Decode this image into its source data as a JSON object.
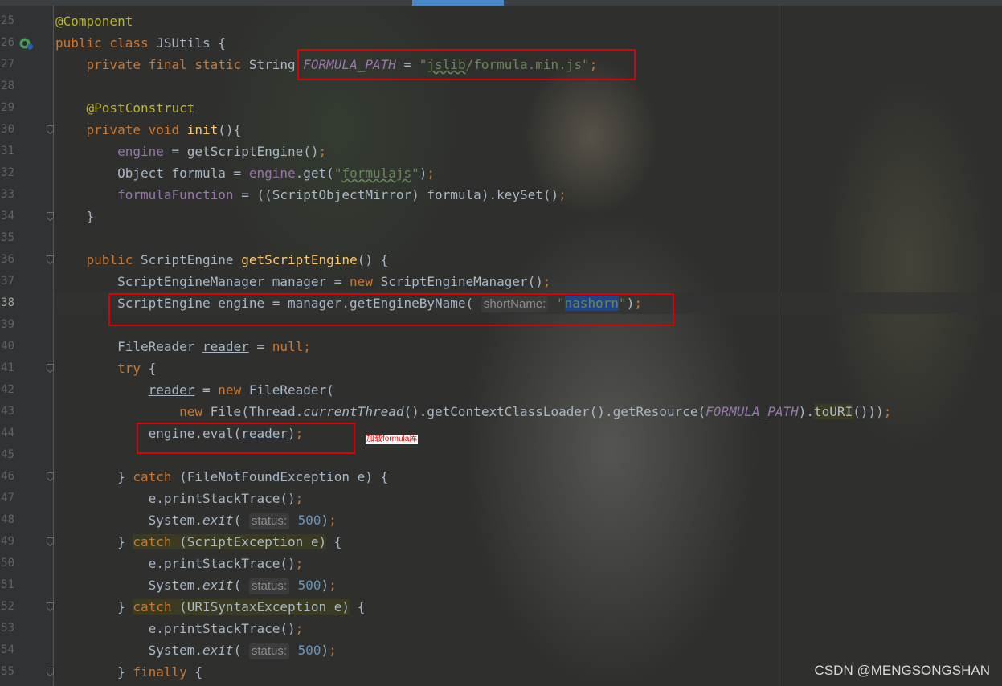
{
  "editor": {
    "lines": [
      {
        "num": "25",
        "tokens": [
          [
            "ann",
            "@Component"
          ]
        ]
      },
      {
        "num": "26",
        "tokens": [
          [
            "kw",
            "public class "
          ],
          [
            "",
            "JSUtils {"
          ]
        ]
      },
      {
        "num": "27",
        "tokens": [
          [
            "",
            "    "
          ],
          [
            "kw",
            "private final static "
          ],
          [
            "",
            "String "
          ],
          [
            "cst",
            "FORMULA_PATH"
          ],
          [
            "",
            " = "
          ],
          [
            "str",
            "\""
          ],
          [
            "str wavy",
            "jslib"
          ],
          [
            "str",
            "/formula.min.js\""
          ],
          [
            "kw",
            ";"
          ]
        ]
      },
      {
        "num": "28",
        "tokens": []
      },
      {
        "num": "29",
        "tokens": [
          [
            "",
            "    "
          ],
          [
            "ann",
            "@PostConstruct"
          ]
        ]
      },
      {
        "num": "30",
        "tokens": [
          [
            "",
            "    "
          ],
          [
            "kw",
            "private void "
          ],
          [
            "fn",
            "init"
          ],
          [
            "",
            "(){"
          ]
        ]
      },
      {
        "num": "31",
        "tokens": [
          [
            "",
            "        "
          ],
          [
            "field",
            "engine"
          ],
          [
            "",
            " = getScriptEngine()"
          ],
          [
            "kw",
            ";"
          ]
        ]
      },
      {
        "num": "32",
        "tokens": [
          [
            "",
            "        Object formula = "
          ],
          [
            "field",
            "engine"
          ],
          [
            "",
            ".get("
          ],
          [
            "str",
            "\""
          ],
          [
            "str wavy",
            "formulajs"
          ],
          [
            "str",
            "\""
          ],
          [
            "",
            ")"
          ],
          [
            "kw",
            ";"
          ]
        ]
      },
      {
        "num": "33",
        "tokens": [
          [
            "",
            "        "
          ],
          [
            "field",
            "formulaFunction"
          ],
          [
            "",
            " = ((ScriptObjectMirror) formula).keySet()"
          ],
          [
            "kw",
            ";"
          ]
        ]
      },
      {
        "num": "34",
        "tokens": [
          [
            "",
            "    }"
          ]
        ]
      },
      {
        "num": "35",
        "tokens": []
      },
      {
        "num": "36",
        "tokens": [
          [
            "",
            "    "
          ],
          [
            "kw",
            "public "
          ],
          [
            "",
            "ScriptEngine "
          ],
          [
            "fn",
            "getScriptEngine"
          ],
          [
            "",
            "() {"
          ]
        ]
      },
      {
        "num": "37",
        "tokens": [
          [
            "",
            "        ScriptEngineManager manager = "
          ],
          [
            "kw",
            "new "
          ],
          [
            "",
            "ScriptEngineManager()"
          ],
          [
            "kw",
            ";"
          ]
        ]
      },
      {
        "num": "38",
        "tokens": [
          [
            "",
            "        ScriptEngine engine = manager.getEngineByName( "
          ],
          [
            "hint",
            "shortName:"
          ],
          [
            "str",
            " \""
          ],
          [
            "sel",
            "nashorn"
          ],
          [
            "str",
            "\""
          ],
          [
            "",
            ")"
          ],
          [
            "kw",
            ";"
          ]
        ]
      },
      {
        "num": "39",
        "tokens": []
      },
      {
        "num": "40",
        "tokens": [
          [
            "",
            "        FileReader "
          ],
          [
            "ul",
            "reader"
          ],
          [
            "",
            " = "
          ],
          [
            "kw",
            "null;"
          ]
        ]
      },
      {
        "num": "41",
        "tokens": [
          [
            "",
            "        "
          ],
          [
            "kw",
            "try "
          ],
          [
            "",
            "{"
          ]
        ]
      },
      {
        "num": "42",
        "tokens": [
          [
            "",
            "            "
          ],
          [
            "ul",
            "reader"
          ],
          [
            "",
            " = "
          ],
          [
            "kw",
            "new "
          ],
          [
            "",
            "FileReader("
          ]
        ]
      },
      {
        "num": "43",
        "tokens": [
          [
            "",
            "                "
          ],
          [
            "kw",
            "new "
          ],
          [
            "",
            "File(Thread."
          ],
          [
            "it",
            "currentThread"
          ],
          [
            "",
            "().getContextClassLoader().getResource("
          ],
          [
            "cst",
            "FORMULA_PATH"
          ],
          [
            "",
            ")."
          ],
          [
            "hlbg",
            "toURI"
          ],
          [
            "",
            "()))"
          ],
          [
            "kw",
            ";"
          ]
        ]
      },
      {
        "num": "44",
        "tokens": [
          [
            "",
            "            engine.eval("
          ],
          [
            "ul",
            "reader"
          ],
          [
            "",
            ")"
          ],
          [
            "kw",
            ";"
          ]
        ]
      },
      {
        "num": "45",
        "tokens": []
      },
      {
        "num": "46",
        "tokens": [
          [
            "",
            "        } "
          ],
          [
            "kw",
            "catch "
          ],
          [
            "",
            "(FileNotFoundException e) {"
          ]
        ]
      },
      {
        "num": "47",
        "tokens": [
          [
            "",
            "            e.printStackTrace()"
          ],
          [
            "kw",
            ";"
          ]
        ]
      },
      {
        "num": "48",
        "tokens": [
          [
            "",
            "            System."
          ],
          [
            "it",
            "exit"
          ],
          [
            "",
            "( "
          ],
          [
            "hint",
            "status:"
          ],
          [
            "num",
            " 500"
          ],
          [
            "",
            ")"
          ],
          [
            "kw",
            ";"
          ]
        ]
      },
      {
        "num": "49",
        "tokens": [
          [
            "",
            "        } "
          ],
          [
            "kw hlbg",
            "catch"
          ],
          [
            "hlbg",
            " (ScriptException e)"
          ],
          [
            "",
            " {"
          ]
        ]
      },
      {
        "num": "50",
        "tokens": [
          [
            "",
            "            e.printStackTrace()"
          ],
          [
            "kw",
            ";"
          ]
        ]
      },
      {
        "num": "51",
        "tokens": [
          [
            "",
            "            System."
          ],
          [
            "it",
            "exit"
          ],
          [
            "",
            "( "
          ],
          [
            "hint",
            "status:"
          ],
          [
            "num",
            " 500"
          ],
          [
            "",
            ")"
          ],
          [
            "kw",
            ";"
          ]
        ]
      },
      {
        "num": "52",
        "tokens": [
          [
            "",
            "        } "
          ],
          [
            "kw hlbg",
            "catch"
          ],
          [
            "hlbg",
            " (URISyntaxException e)"
          ],
          [
            "",
            " {"
          ]
        ]
      },
      {
        "num": "53",
        "tokens": [
          [
            "",
            "            e.printStackTrace()"
          ],
          [
            "kw",
            ";"
          ]
        ]
      },
      {
        "num": "54",
        "tokens": [
          [
            "",
            "            System."
          ],
          [
            "it",
            "exit"
          ],
          [
            "",
            "( "
          ],
          [
            "hint",
            "status:"
          ],
          [
            "num",
            " 500"
          ],
          [
            "",
            ")"
          ],
          [
            "kw",
            ";"
          ]
        ]
      },
      {
        "num": "55",
        "tokens": [
          [
            "",
            "        } "
          ],
          [
            "kw",
            "finally "
          ],
          [
            "",
            "{"
          ]
        ]
      }
    ],
    "active_line": "38",
    "fold_lines": [
      "30",
      "34",
      "36",
      "41",
      "46",
      "49",
      "52",
      "55"
    ]
  },
  "annotation": {
    "comment": "加载formula库"
  },
  "watermark": "CSDN @MENGSONGSHAN",
  "colors": {
    "keyword": "#cc7832",
    "annotation": "#bbb529",
    "string": "#6a8759",
    "number": "#6897bb",
    "field": "#9876aa",
    "method": "#ffc66d",
    "text": "#a9b7c6",
    "highlight_box": "#e00000"
  }
}
